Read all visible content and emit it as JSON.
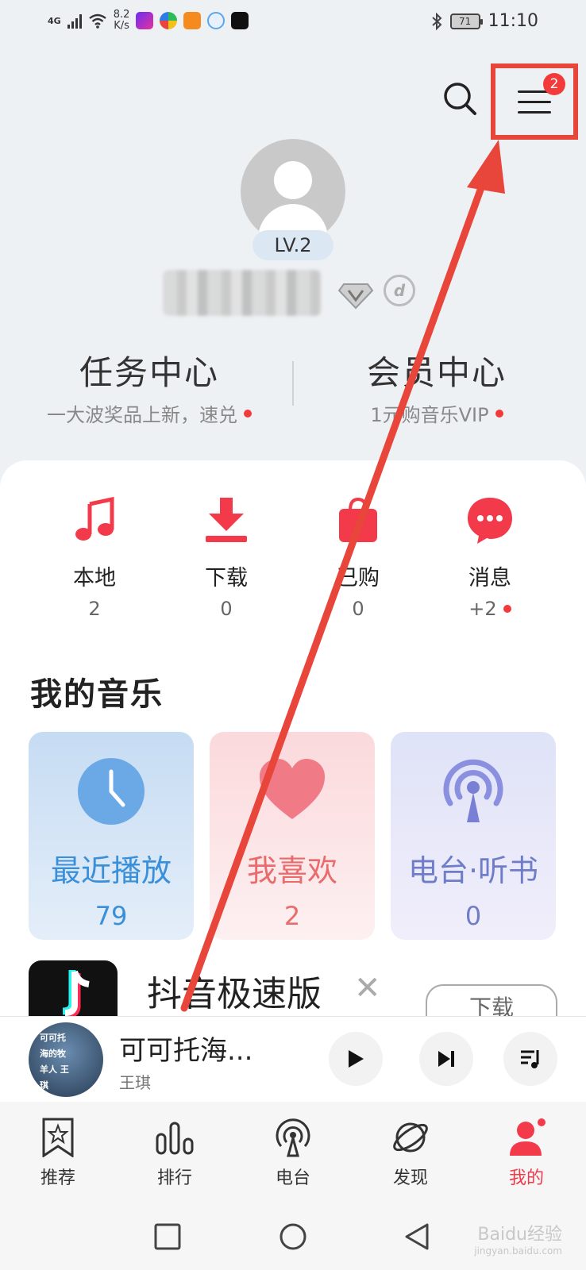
{
  "status_bar": {
    "network": "4G",
    "speed_value": "8.2",
    "speed_unit": "K/s",
    "battery": "71",
    "time": "11:10"
  },
  "header": {
    "menu_badge": "2"
  },
  "profile": {
    "level": "LV.2"
  },
  "centers": {
    "task_title": "任务中心",
    "task_sub": "一大波奖品上新，速兑",
    "vip_title": "会员中心",
    "vip_sub": "1元购音乐VIP"
  },
  "quick_actions": [
    {
      "label": "本地",
      "count": "2",
      "icon": "music-note-icon"
    },
    {
      "label": "下载",
      "count": "0",
      "icon": "download-icon"
    },
    {
      "label": "已购",
      "count": "0",
      "icon": "shopping-bag-icon"
    },
    {
      "label": "消息",
      "count": "+2",
      "icon": "message-icon"
    }
  ],
  "my_music": {
    "title": "我的音乐",
    "tiles": [
      {
        "label": "最近播放",
        "count": "79",
        "color": "#3a8fd9"
      },
      {
        "label": "我喜欢",
        "count": "2",
        "color": "#e96b6b"
      },
      {
        "label": "电台·听书",
        "count": "0",
        "color": "#6f7dc8"
      }
    ]
  },
  "ad": {
    "title": "抖音极速版",
    "close": "✕",
    "button": "下载"
  },
  "player": {
    "song": "可可托海...",
    "artist": "王琪",
    "cover_text": "可可托海的牧羊人 王琪"
  },
  "bottom_nav": [
    {
      "label": "推荐",
      "icon": "star-bookmark-icon",
      "active": false
    },
    {
      "label": "排行",
      "icon": "chart-bars-icon",
      "active": false
    },
    {
      "label": "电台",
      "icon": "radio-icon",
      "active": false
    },
    {
      "label": "发现",
      "icon": "planet-icon",
      "active": false
    },
    {
      "label": "我的",
      "icon": "profile-icon",
      "active": true
    }
  ],
  "watermark": {
    "line1": "Baidu经验",
    "line2": "jingyan.baidu.com"
  },
  "colors": {
    "accent_red": "#f33a3a",
    "annotation_red": "#e8463a"
  }
}
